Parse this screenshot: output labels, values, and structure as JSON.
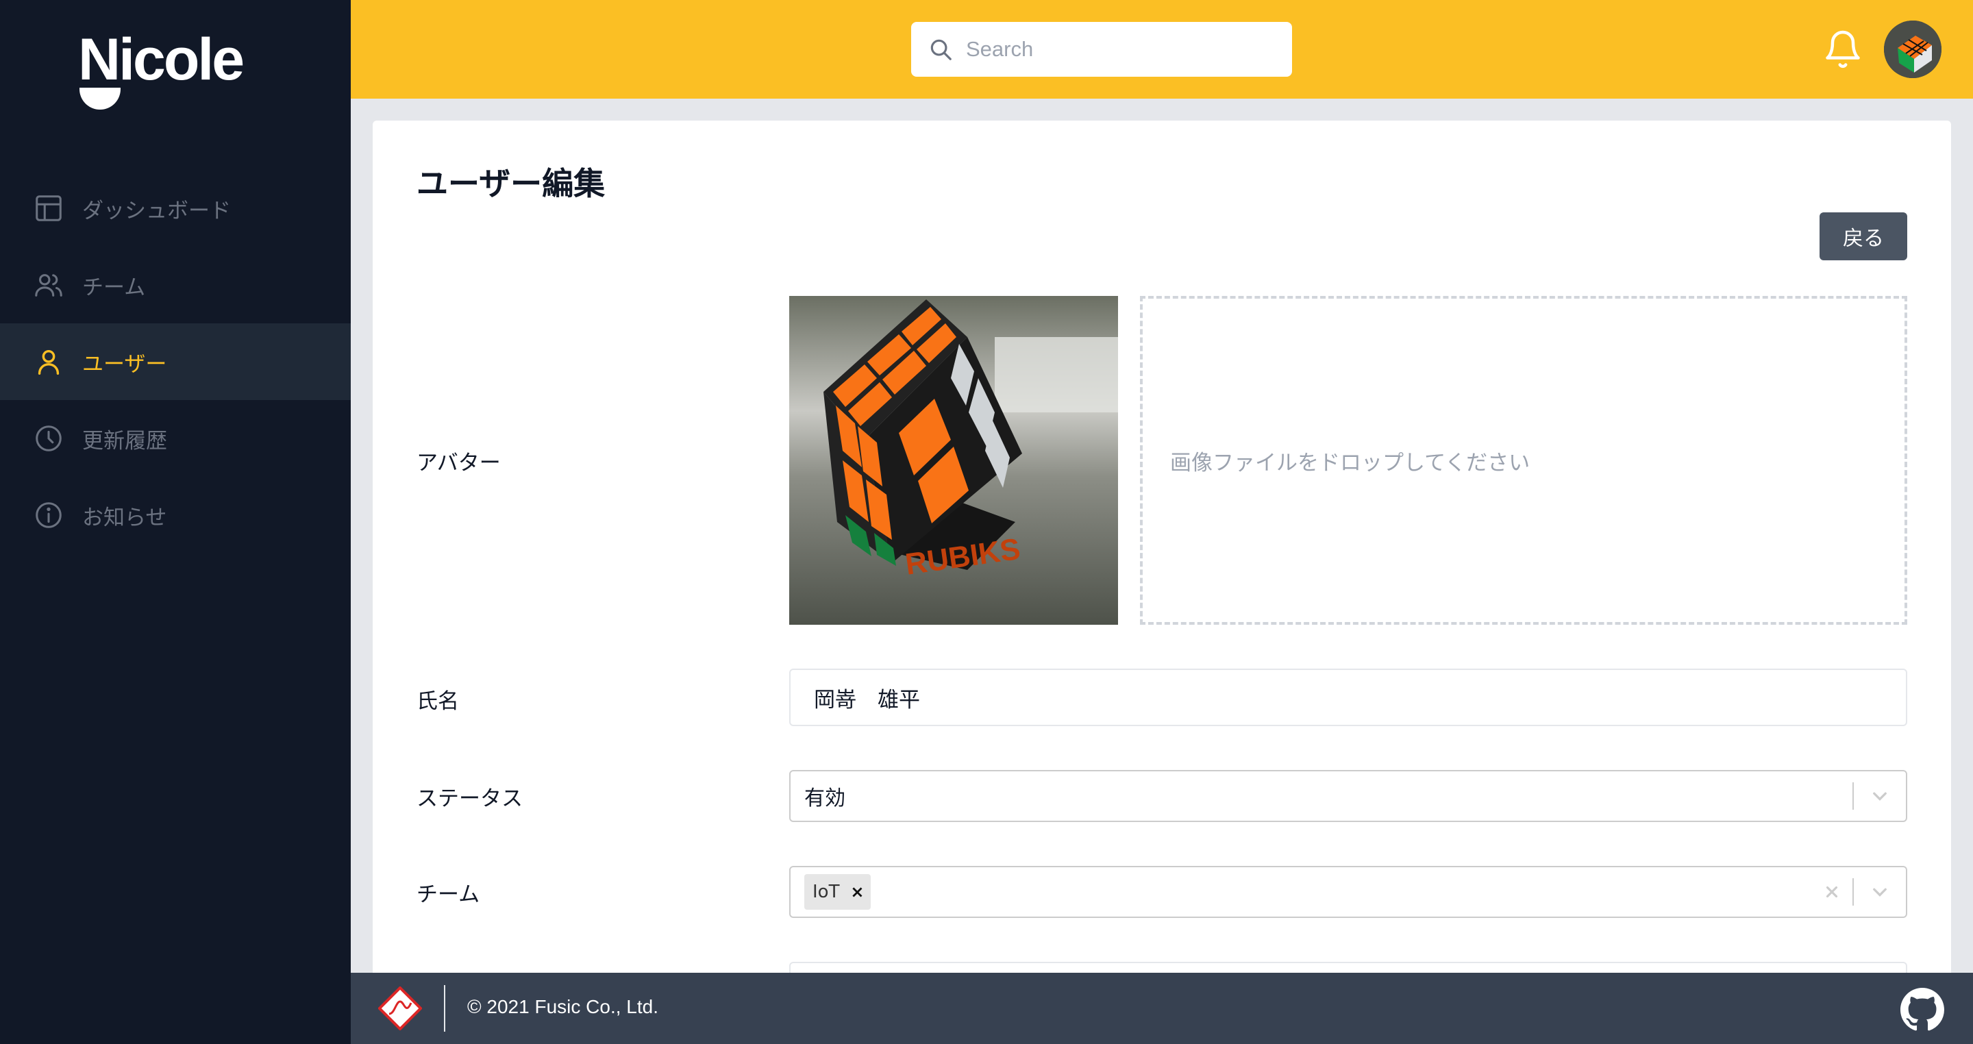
{
  "app": {
    "logo": "Nicole"
  },
  "sidebar": {
    "items": [
      {
        "label": "ダッシュボード",
        "icon": "dashboard-icon",
        "active": false
      },
      {
        "label": "チーム",
        "icon": "users-icon",
        "active": false
      },
      {
        "label": "ユーザー",
        "icon": "user-icon",
        "active": true
      },
      {
        "label": "更新履歴",
        "icon": "clock-icon",
        "active": false
      },
      {
        "label": "お知らせ",
        "icon": "info-icon",
        "active": false
      }
    ]
  },
  "header": {
    "search": {
      "placeholder": "Search",
      "value": ""
    }
  },
  "page": {
    "title": "ユーザー編集",
    "back_label": "戻る"
  },
  "form": {
    "avatar": {
      "label": "アバター",
      "dropzone_text": "画像ファイルをドロップしてください"
    },
    "name": {
      "label": "氏名",
      "value": "岡嵜　雄平"
    },
    "status": {
      "label": "ステータス",
      "value": "有効"
    },
    "team": {
      "label": "チーム",
      "tags": [
        "IoT"
      ],
      "clear_symbol": "×"
    }
  },
  "footer": {
    "copyright": "© 2021 Fusic Co., Ltd."
  },
  "colors": {
    "sidebar_bg": "#111827",
    "header_bg": "#fbbf24",
    "accent": "#fbbf24",
    "footer_bg": "#374151",
    "button_bg": "#4b5563"
  }
}
